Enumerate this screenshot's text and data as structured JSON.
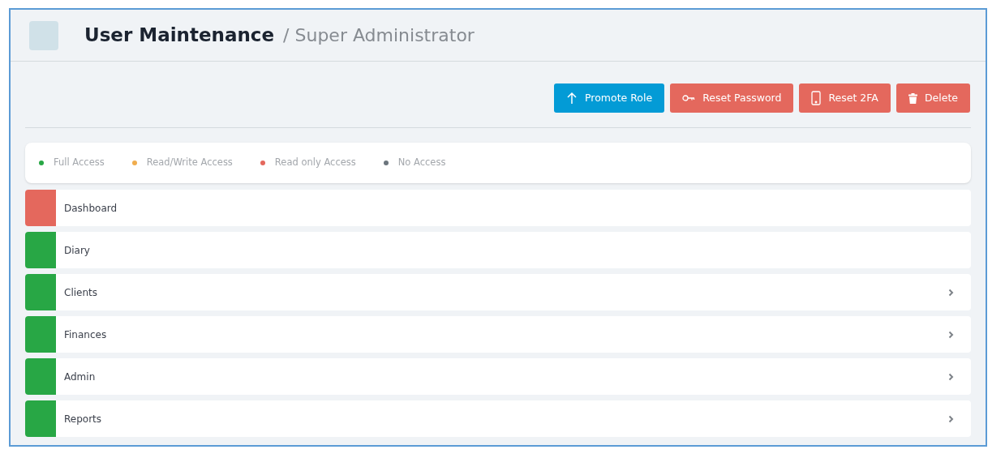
{
  "header": {
    "title": "User Maintenance",
    "subtitle": "/ Super Administrator"
  },
  "actions": [
    {
      "label": "Promote Role",
      "kind": "primary"
    },
    {
      "label": "Reset Password",
      "kind": "danger"
    },
    {
      "label": "Reset 2FA",
      "kind": "danger"
    },
    {
      "label": "Delete",
      "kind": "danger"
    }
  ],
  "legend": [
    {
      "label": "Full Access",
      "color": "#28a745"
    },
    {
      "label": "Read/Write Access",
      "color": "#f0ad4e"
    },
    {
      "label": "Read only Access",
      "color": "#e4685d"
    },
    {
      "label": "No Access",
      "color": "#6c757d"
    }
  ],
  "modules": [
    {
      "label": "Dashboard",
      "color": "#e4685d",
      "expandable": false
    },
    {
      "label": "Diary",
      "color": "#28a745",
      "expandable": false
    },
    {
      "label": "Clients",
      "color": "#28a745",
      "expandable": true
    },
    {
      "label": "Finances",
      "color": "#28a745",
      "expandable": true
    },
    {
      "label": "Admin",
      "color": "#28a745",
      "expandable": true
    },
    {
      "label": "Reports",
      "color": "#28a745",
      "expandable": true
    }
  ]
}
